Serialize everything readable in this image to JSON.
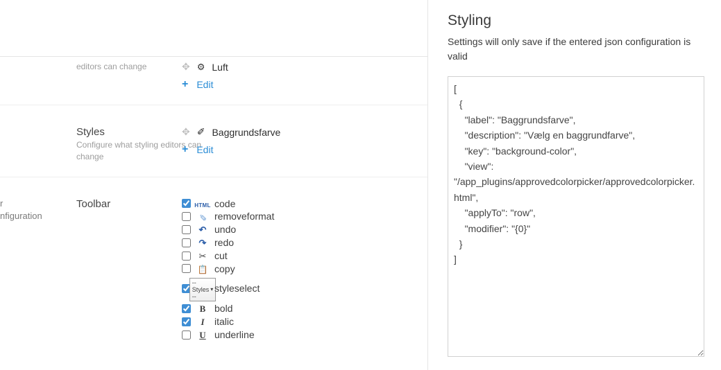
{
  "leftNavFragment": {
    "line1": "r",
    "line2": "nfiguration"
  },
  "settingsRow": {
    "descFragment": "editors can change",
    "item": "Luft",
    "edit": "Edit"
  },
  "stylesRow": {
    "title": "Styles",
    "desc": "Configure what styling editors can change",
    "item": "Baggrundsfarve",
    "edit": "Edit"
  },
  "toolbarRow": {
    "title": "Toolbar",
    "options": [
      {
        "key": "code",
        "label": "code",
        "checked": true,
        "glyph": "html"
      },
      {
        "key": "removeformat",
        "label": "removeformat",
        "checked": false,
        "glyph": "erase"
      },
      {
        "key": "undo",
        "label": "undo",
        "checked": false,
        "glyph": "undo"
      },
      {
        "key": "redo",
        "label": "redo",
        "checked": false,
        "glyph": "redo"
      },
      {
        "key": "cut",
        "label": "cut",
        "checked": false,
        "glyph": "cut"
      },
      {
        "key": "copy",
        "label": "copy",
        "checked": false,
        "glyph": "copy"
      },
      {
        "key": "styleselect",
        "label": "styleselect",
        "checked": true,
        "glyph": "styles"
      },
      {
        "key": "bold",
        "label": "bold",
        "checked": true,
        "glyph": "bold"
      },
      {
        "key": "italic",
        "label": "italic",
        "checked": true,
        "glyph": "italic"
      },
      {
        "key": "underline",
        "label": "underline",
        "checked": false,
        "glyph": "underline"
      }
    ],
    "stylesDropdownLabel": "-- Styles --"
  },
  "rightPane": {
    "title": "Styling",
    "hint": "Settings will only save if the entered json configuration is valid",
    "jsonText": "[\n  {\n    \"label\": \"Baggrundsfarve\",\n    \"description\": \"Vælg en baggrundfarve\",\n    \"key\": \"background-color\",\n    \"view\": \"/app_plugins/approvedcolorpicker/approvedcolorpicker.html\",\n    \"applyTo\": \"row\",\n    \"modifier\": \"{0}\"\n  }\n]"
  }
}
